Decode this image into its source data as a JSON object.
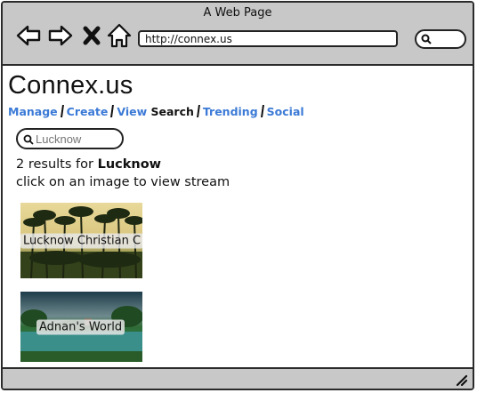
{
  "window": {
    "title": "A Web Page"
  },
  "browser": {
    "address_value": "http://connex.us",
    "icons": [
      "back-icon",
      "forward-icon",
      "close-icon",
      "home-icon",
      "search-icon"
    ]
  },
  "site": {
    "title": "Connex.us"
  },
  "nav": {
    "items": [
      {
        "label": "Manage"
      },
      {
        "label": "Create"
      },
      {
        "label": "View"
      },
      {
        "label": "Search",
        "current": true
      },
      {
        "label": "Trending"
      },
      {
        "label": "Social"
      }
    ]
  },
  "search": {
    "value": "",
    "placeholder": "Lucknow"
  },
  "results": {
    "count_text": "2 results for ",
    "query": "Lucknow",
    "hint": "click on an image to view stream",
    "items": [
      {
        "label": "Lucknow Christian C"
      },
      {
        "label": "Adnan's World"
      }
    ]
  },
  "colors": {
    "link": "#3b7ad6",
    "chrome": "#c8c8c8",
    "border": "#2b2b2b"
  }
}
